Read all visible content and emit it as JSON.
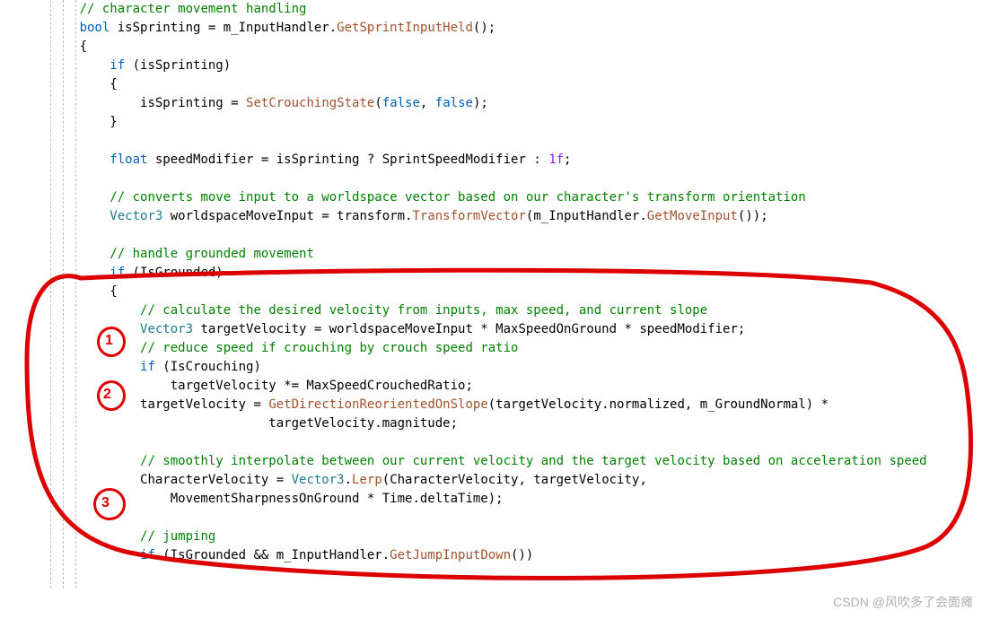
{
  "code": {
    "l01": "// character movement handling",
    "l02a": "bool",
    "l02b": " isSprinting = m_InputHandler.",
    "l02c": "GetSprintInputHeld",
    "l02d": "();",
    "l03": "{",
    "l04a": "if",
    "l04b": " (isSprinting)",
    "l05": "{",
    "l06a": "isSprinting = ",
    "l06b": "SetCrouchingState",
    "l06c": "(",
    "l06d": "false",
    "l06e": ", ",
    "l06f": "false",
    "l06g": ");",
    "l07": "}",
    "l09a": "float",
    "l09b": " speedModifier = isSprinting ? SprintSpeedModifier : ",
    "l09c": "1f",
    "l09d": ";",
    "l11": "// converts move input to a worldspace vector based on our character's transform orientation",
    "l12a": "Vector3",
    "l12b": " worldspaceMoveInput = transform.",
    "l12c": "TransformVector",
    "l12d": "(m_InputHandler.",
    "l12e": "GetMoveInput",
    "l12f": "());",
    "l14": "// handle grounded movement",
    "l15a": "if",
    "l15b": " (IsGrounded)",
    "l16": "{",
    "l18": "// calculate the desired velocity from inputs, max speed, and current slope",
    "l19a": "Vector3",
    "l19b": " targetVelocity = worldspaceMoveInput * MaxSpeedOnGround * speedModifier;",
    "l20": "// reduce speed if crouching by crouch speed ratio",
    "l21a": "if",
    "l21b": " (IsCrouching)",
    "l22": "targetVelocity *= MaxSpeedCrouchedRatio;",
    "l23a": "targetVelocity = ",
    "l23b": "GetDirectionReorientedOnSlope",
    "l23c": "(targetVelocity.normalized, m_GroundNormal) *",
    "l24": "targetVelocity.magnitude;",
    "l26": "// smoothly interpolate between our current velocity and the target velocity based on acceleration speed",
    "l27a": "CharacterVelocity = ",
    "l27b": "Vector3",
    "l27c": ".",
    "l27d": "Lerp",
    "l27e": "(CharacterVelocity, targetVelocity,",
    "l28": "MovementSharpnessOnGround * Time.deltaTime);",
    "l30": "// jumping",
    "l31a": "if",
    "l31b": " (IsGrounded && m_InputHandler.",
    "l31c": "GetJumpInputDown",
    "l31d": "())"
  },
  "annotations": {
    "n1": "1",
    "n2": "2",
    "n3": "3"
  },
  "watermark": "CSDN @风吹多了会面瘫"
}
